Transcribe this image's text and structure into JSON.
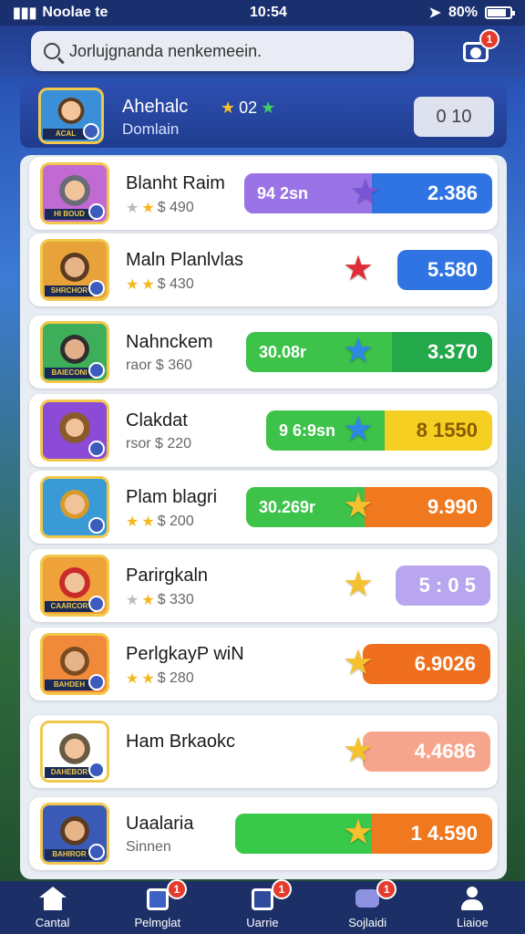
{
  "status": {
    "carrier": "Noolae te",
    "time": "10:54",
    "battery": "80%"
  },
  "search": {
    "placeholder": "Jorlujgnanda nenkemeein."
  },
  "camera_badge": "1",
  "player": {
    "name": "Ahehalc",
    "subtitle": "Domlain",
    "stars_text": "02",
    "score": "0 10",
    "avatar_label": "ACAL"
  },
  "rows": [
    {
      "name": "Blanht Raim",
      "sub": "$ 490",
      "stars": [
        "grey",
        "gold"
      ],
      "left_text": "94 2sn",
      "value": "2.386",
      "avatar_label": "HI BOUD",
      "star_color": "#7a55d6",
      "left_color": "#9a74e6",
      "right_color": "#2f74e2"
    },
    {
      "name": "Maln Planlvlas",
      "sub": "$ 430",
      "stars": [
        "gold",
        "gold"
      ],
      "left_text": "",
      "value": "5.580",
      "avatar_label": "SHRCHOR",
      "star_color": "#e02c36",
      "left_color": "",
      "right_color": "#2f74e2"
    },
    {
      "name": "Nahnckem",
      "sub": "raor $ 360",
      "stars": [],
      "left_text": "30.08r",
      "value": "3.370",
      "avatar_label": "BAIECONI",
      "star_color": "#2f87e6",
      "left_color": "#3dc24a",
      "right_color": "#23a84a"
    },
    {
      "name": "Clakdat",
      "sub": "rsor $ 220",
      "stars": [],
      "left_text": "9 6:9sn",
      "value": "8 1550",
      "avatar_label": "",
      "star_color": "#2f87e6",
      "left_color": "#3dc24a",
      "right_color": "#f5d023"
    },
    {
      "name": "Plam blagri",
      "sub": "$ 200",
      "stars": [
        "gold",
        "gold"
      ],
      "left_text": "30.269r",
      "value": "9.990",
      "avatar_label": "",
      "star_color": "#f5c12c",
      "left_color": "#3dc24a",
      "right_color": "#f0781e"
    },
    {
      "name": "Parirgkaln",
      "sub": "$ 330",
      "stars": [
        "grey",
        "gold"
      ],
      "left_text": "",
      "value": "5 : 0 5",
      "avatar_label": "CAARCOR",
      "star_color": "#f5c12c",
      "left_color": "",
      "right_color": "#b8a6ee"
    },
    {
      "name": "PerlgkayP wiN",
      "sub": "$ 280",
      "stars": [
        "gold",
        "gold"
      ],
      "left_text": "",
      "value": "6.9026",
      "avatar_label": "BAHDEH",
      "star_color": "#f5c12c",
      "left_color": "",
      "right_color": "#ef6f1e"
    },
    {
      "name": "Ham Brkaokc",
      "sub": "",
      "stars": [],
      "left_text": "",
      "value": "4.4686",
      "avatar_label": "DAHEBOR",
      "star_color": "#f5c12c",
      "left_color": "",
      "right_color": "#f6a68c"
    },
    {
      "name": "Uaalaria",
      "sub": "Sinnen",
      "stars": [],
      "left_text": "",
      "value": "1 4.590",
      "avatar_label": "BAHIROR",
      "star_color": "#f5c12c",
      "left_color": "#39c94a",
      "right_color": "#f0781e"
    }
  ],
  "nav": [
    {
      "label": "Cantal",
      "badge": ""
    },
    {
      "label": "Pelmglat",
      "badge": "1"
    },
    {
      "label": "Uarrie",
      "badge": "1"
    },
    {
      "label": "Sojlaidi",
      "badge": "1"
    },
    {
      "label": "Liaioe",
      "badge": ""
    }
  ]
}
